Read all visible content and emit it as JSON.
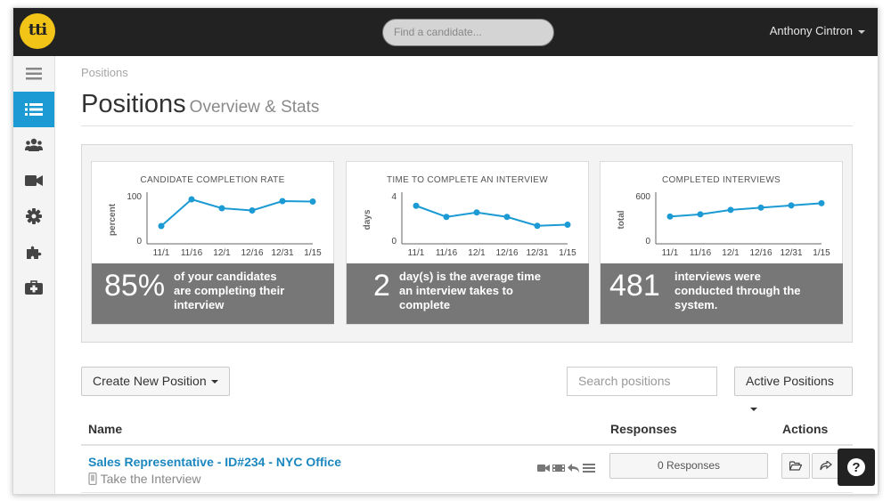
{
  "topbar": {
    "logo_text": "tti",
    "search_placeholder": "Find a candidate...",
    "user_name": "Anthony Cintron"
  },
  "sidebar": {
    "items": [
      {
        "icon": "menu-icon",
        "active": false
      },
      {
        "icon": "list-icon",
        "active": true
      },
      {
        "icon": "users-icon",
        "active": false
      },
      {
        "icon": "video-camera-icon",
        "active": false
      },
      {
        "icon": "gear-icon",
        "active": false
      },
      {
        "icon": "puzzle-icon",
        "active": false
      },
      {
        "icon": "medkit-icon",
        "active": false
      }
    ]
  },
  "page": {
    "breadcrumb": "Positions",
    "title": "Positions",
    "subtitle": "Overview & Stats"
  },
  "stats": [
    {
      "title": "CANDIDATE COMPLETION RATE",
      "big": "85%",
      "desc": [
        "of your candidates",
        "are completing their",
        "interview"
      ],
      "chart_data": {
        "type": "line",
        "ylabel": "percent",
        "ylim": [
          0,
          100
        ],
        "yticks": [
          "0",
          "100"
        ],
        "categories": [
          "11/1",
          "11/16",
          "12/1",
          "12/16",
          "12/31",
          "1/15"
        ],
        "values": [
          32,
          92,
          72,
          67,
          88,
          87
        ]
      }
    },
    {
      "title": "TIME TO COMPLETE AN INTERVIEW",
      "big": "2",
      "desc": [
        "day(s) is the average time",
        "an interview takes to",
        "complete"
      ],
      "chart_data": {
        "type": "line",
        "ylabel": "days",
        "ylim": [
          0,
          4
        ],
        "yticks": [
          "0",
          "4"
        ],
        "categories": [
          "11/1",
          "11/16",
          "12/1",
          "12/16",
          "12/31",
          "1/15"
        ],
        "values": [
          3.1,
          2.1,
          2.5,
          2.1,
          1.3,
          1.4
        ]
      }
    },
    {
      "title": "COMPLETED INTERVIEWS",
      "big": "481",
      "desc": [
        "interviews were",
        "conducted through the",
        "system."
      ],
      "chart_data": {
        "type": "line",
        "ylabel": "total",
        "ylim": [
          0,
          600
        ],
        "yticks": [
          "0",
          "600"
        ],
        "categories": [
          "11/1",
          "11/16",
          "12/1",
          "12/16",
          "12/31",
          "1/15"
        ],
        "values": [
          320,
          350,
          410,
          440,
          470,
          500
        ]
      }
    }
  ],
  "toolbar": {
    "create_label": "Create New Position",
    "search_placeholder": "Search positions",
    "filter_label": "Active Positions"
  },
  "table": {
    "headers": {
      "name": "Name",
      "responses": "Responses",
      "actions": "Actions"
    },
    "rows": [
      {
        "title": "Sales Representative - ID#234 - NYC Office",
        "subtitle": "Take the Interview",
        "responses": "0 Responses"
      }
    ]
  },
  "colors": {
    "accent": "#1b9ad4",
    "topbar": "#222222",
    "logo": "#f2c418",
    "stat_foot": "#777777",
    "link": "#1b87bf"
  }
}
